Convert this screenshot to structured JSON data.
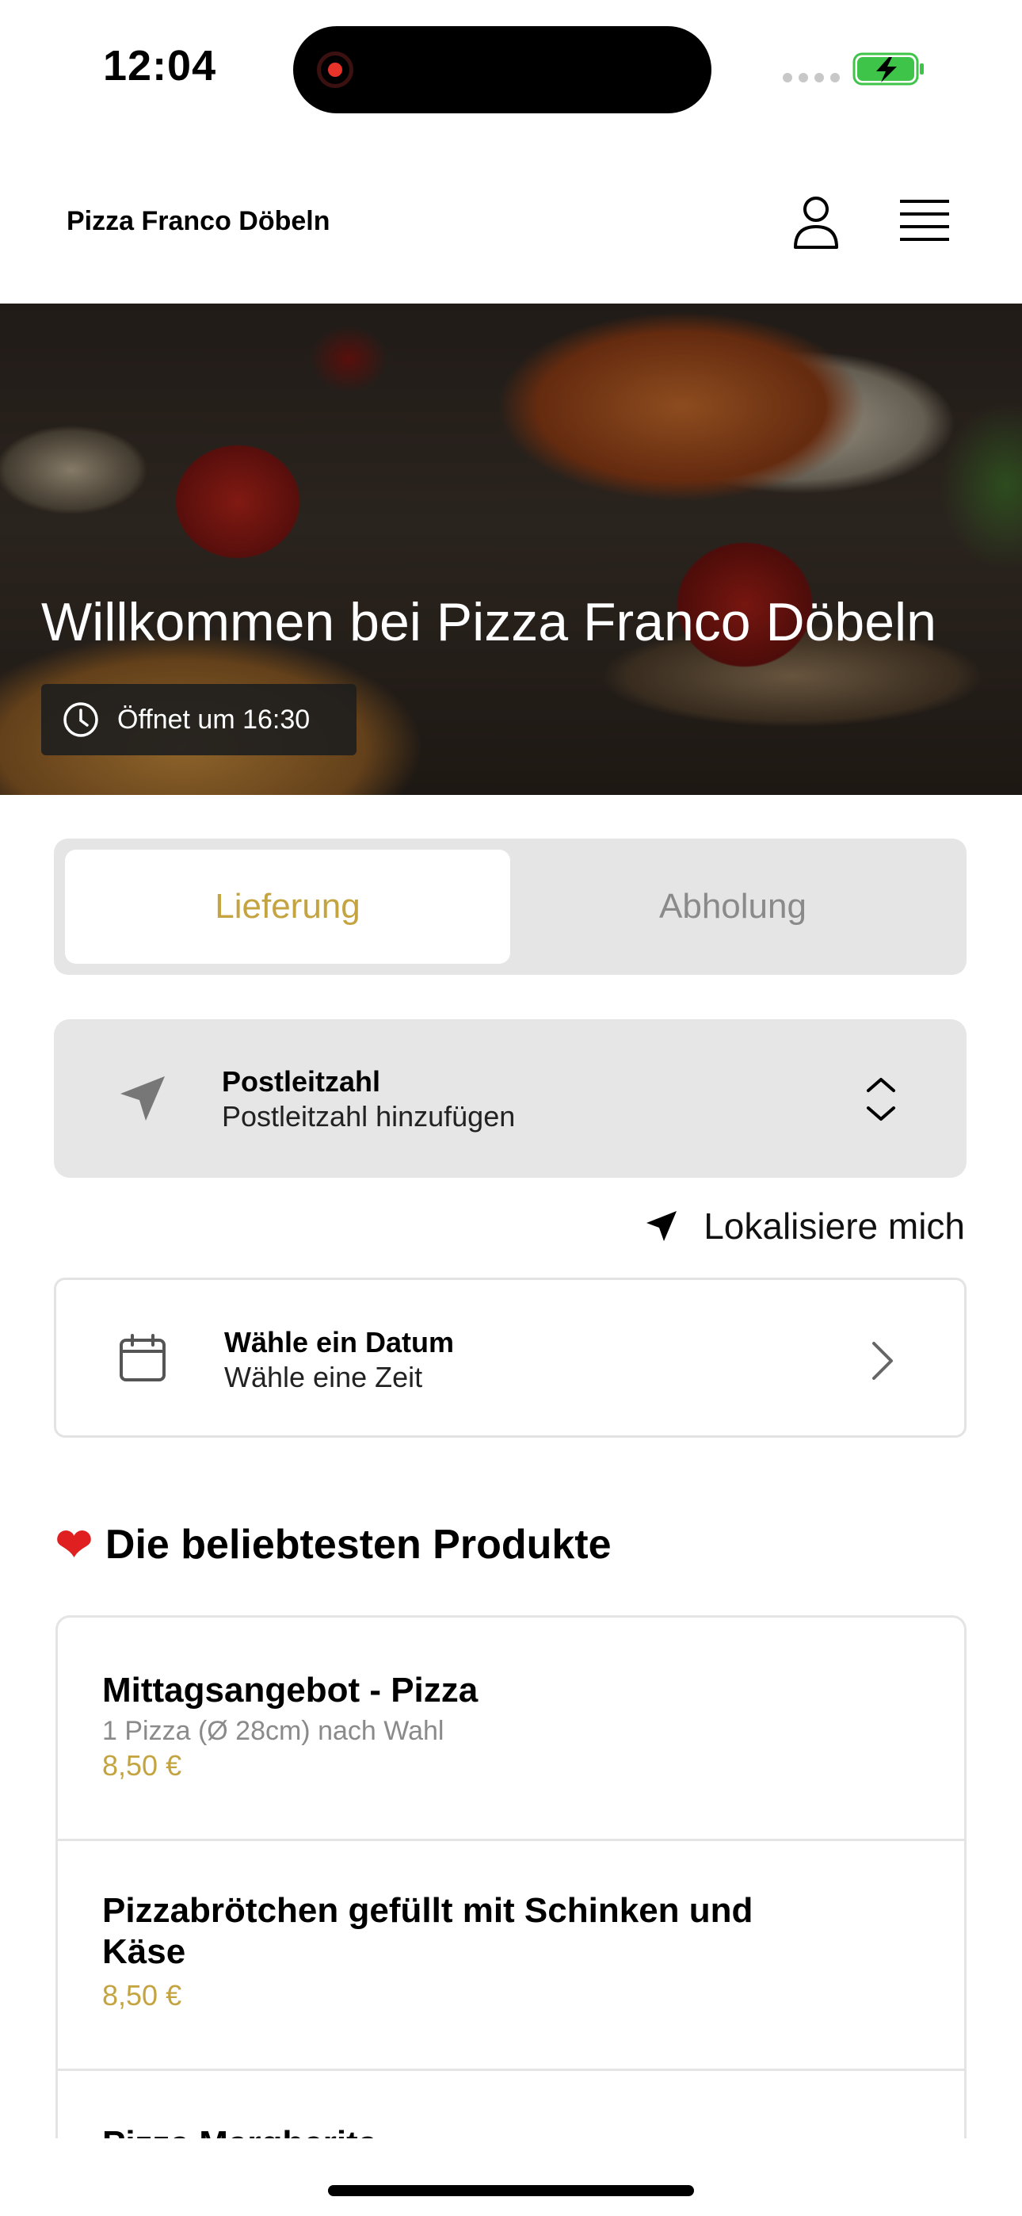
{
  "status_bar": {
    "time": "12:04"
  },
  "header": {
    "brand": "Pizza Franco Döbeln"
  },
  "hero": {
    "title": "Willkommen bei Pizza Franco Döbeln",
    "opening": "Öffnet um 16:30"
  },
  "order_mode": {
    "delivery": "Lieferung",
    "pickup": "Abholung",
    "selected": "Lieferung"
  },
  "postal": {
    "label": "Postleitzahl",
    "placeholder": "Postleitzahl hinzufügen"
  },
  "locate": {
    "label": "Lokalisiere mich"
  },
  "date": {
    "title": "Wähle ein Datum",
    "subtitle": "Wähle eine Zeit"
  },
  "popular": {
    "title": "Die beliebtesten Produkte",
    "products": [
      {
        "name": "Mittagsangebot - Pizza",
        "description": "1 Pizza (Ø 28cm) nach Wahl",
        "price": "8,50 €"
      },
      {
        "name": "Pizzabrötchen gefüllt mit Schinken und Käse",
        "price": "8,50 €"
      },
      {
        "name": "Pizza Margherita"
      }
    ]
  },
  "colors": {
    "accent": "#c4a440",
    "segment_bg": "#e5e5e5",
    "battery": "#3fc44a"
  },
  "icons": [
    "user-icon",
    "menu-icon",
    "clock-icon",
    "location-arrow-icon",
    "chevron-up-down-icon",
    "calendar-icon",
    "chevron-right-icon",
    "heart-icon"
  ]
}
